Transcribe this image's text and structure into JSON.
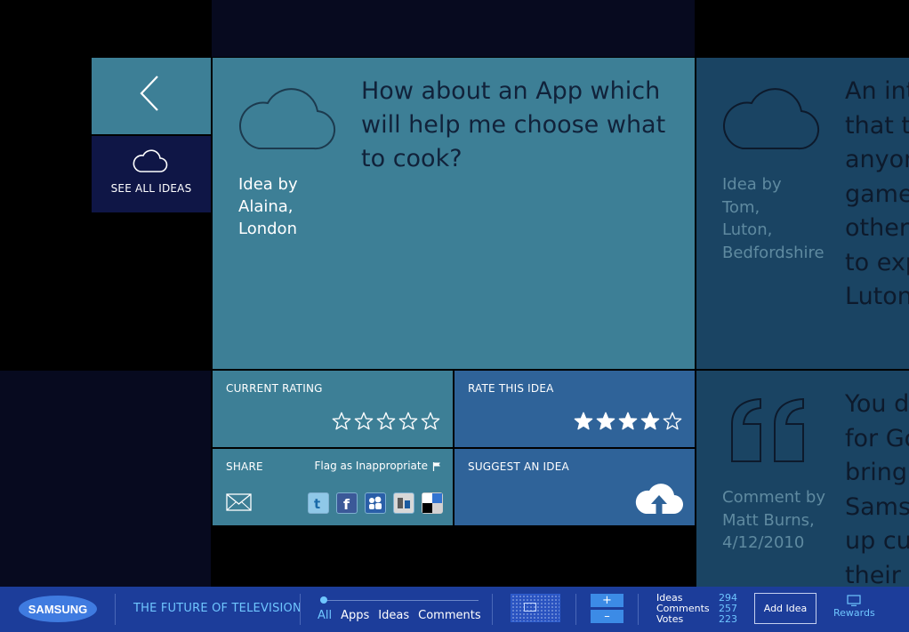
{
  "navigation": {
    "see_all_label": "SEE ALL IDEAS"
  },
  "idea_main": {
    "author_prefix": "Idea by",
    "author_name": "Alaina,",
    "author_location": "London",
    "question": "How about an App which will help me choose what to cook?"
  },
  "idea_side": {
    "author_prefix": "Idea by",
    "author_name": "Tom,",
    "author_location_1": "Luton,",
    "author_location_2": "Bedfordshire",
    "text_lines": [
      "An int",
      "that t",
      "anyon",
      "games",
      "other",
      "to exp",
      "Luton"
    ]
  },
  "comment_side": {
    "author_prefix": "Comment by",
    "author_name": "Matt Burns,",
    "date": "4/12/2010",
    "text_lines": [
      "You d",
      "for Go",
      "bring",
      "Samsu",
      "up cu",
      "their"
    ]
  },
  "current_rating": {
    "label": "CURRENT RATING",
    "stars_total": 5,
    "stars_filled": 0
  },
  "rate_idea": {
    "label": "RATE THIS IDEA",
    "stars_total": 5,
    "stars_filled": 4
  },
  "share": {
    "label": "SHARE",
    "flag_label": "Flag as Inappropriate",
    "icons": [
      "mail-icon",
      "twitter-icon",
      "facebook-icon",
      "myspace-icon",
      "digg-icon",
      "delicious-icon"
    ]
  },
  "suggest": {
    "label": "SUGGEST AN IDEA"
  },
  "bottom_bar": {
    "logo_text": "SAMSUNG",
    "tagline": "THE FUTURE OF TELEVISION",
    "filters": [
      "All",
      "Apps",
      "Ideas",
      "Comments"
    ],
    "active_filter": "All",
    "zoom_in": "+",
    "zoom_out": "–",
    "stats": {
      "ideas_label": "Ideas",
      "comments_label": "Comments",
      "votes_label": "Votes",
      "ideas_value": "294",
      "comments_value": "257",
      "votes_value": "223"
    },
    "add_idea_label": "Add Idea",
    "rewards_label": "Rewards"
  },
  "colors": {
    "tile_teal": "#3d7f96",
    "tile_blue": "#2f6399",
    "tile_navy": "#0f1646",
    "tile_side": "#1a4463",
    "bar_blue": "#1c3d9a",
    "accent_cyan": "#6fc6ff"
  }
}
